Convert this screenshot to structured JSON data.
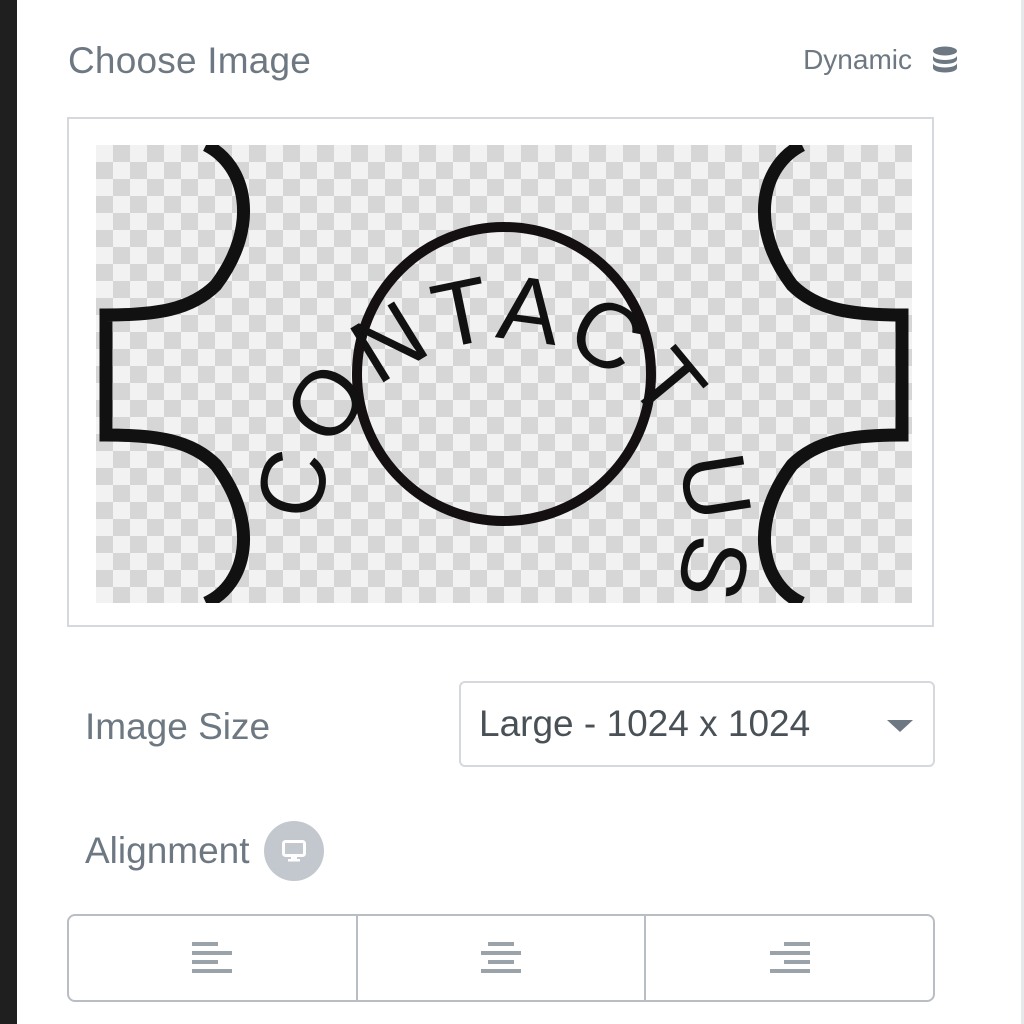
{
  "choose_image": {
    "title": "Choose Image",
    "dynamic_label": "Dynamic",
    "dynamic_icon": "database-icon",
    "preview_text": "CONTACT US TODAY"
  },
  "image_size": {
    "label": "Image Size",
    "selected": "Large - 1024 x 1024"
  },
  "alignment": {
    "label": "Alignment",
    "device_icon": "desktop-icon",
    "options": [
      "align-left-icon",
      "align-center-icon",
      "align-right-icon"
    ]
  },
  "colors": {
    "label_text": "#6d7882",
    "border": "#d5d8dc",
    "select_text": "#495157"
  }
}
